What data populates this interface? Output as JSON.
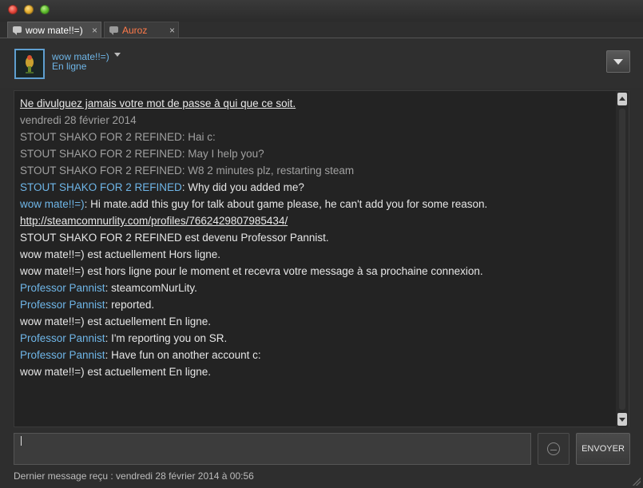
{
  "tabs": [
    {
      "label": "wow mate!!=)",
      "close": "×",
      "active": true
    },
    {
      "label": "Auroz",
      "close": "×",
      "active": false
    }
  ],
  "header": {
    "friend_name": "wow mate!!=)",
    "status": "En ligne"
  },
  "chat": {
    "notice": "Ne divulguez jamais votre mot de passe à qui que ce soit.",
    "date": "vendredi 28 février 2014",
    "old_messages": [
      {
        "sender": "STOUT SHAKO FOR 2 REFINED",
        "text": ": Hai c:"
      },
      {
        "sender": "STOUT SHAKO FOR 2 REFINED",
        "text": ": May I help you?"
      },
      {
        "sender": "STOUT SHAKO FOR 2 REFINED",
        "text": ": W8 2 minutes plz, restarting steam"
      }
    ],
    "msg_why": {
      "sender": "STOUT SHAKO FOR 2 REFINED",
      "text": ": Why did you added me?"
    },
    "msg_hi": {
      "sender": "wow mate!!=)",
      "text": ": Hi mate.add this guy for talk about game please, he can't add you for some reason."
    },
    "link": "http://steamcomnurlity.com/profiles/7662429807985434/",
    "sys_renamed": "STOUT SHAKO FOR 2 REFINED est devenu Professor Pannist.",
    "sys_offline": "wow mate!!=) est actuellement Hors ligne.",
    "sys_away": "wow mate!!=) est hors ligne pour le moment et recevra votre message à sa prochaine connexion.",
    "msg_p1": {
      "sender": "Professor Pannist",
      "text": ": steamcomNurLity."
    },
    "msg_p2": {
      "sender": "Professor Pannist",
      "text": ": reported."
    },
    "sys_online1": "wow mate!!=) est actuellement En ligne.",
    "msg_p3": {
      "sender": "Professor Pannist",
      "text": ": I'm reporting you on SR."
    },
    "msg_p4": {
      "sender": "Professor Pannist",
      "text": ": Have fun on another account c:"
    },
    "sys_online2": "wow mate!!=) est actuellement En ligne."
  },
  "compose": {
    "send_label": "ENVOYER",
    "value": ""
  },
  "footer": {
    "last_message": "Dernier message reçu : vendredi 28 février 2014 à 00:56"
  },
  "icons": {
    "tab": "chat-bubble-icon",
    "emoji": "emoticon-icon",
    "menu": "dropdown-arrow-icon"
  },
  "colors": {
    "name_blue": "#6fb6e8",
    "inactive_tab": "#ff7a4a",
    "background": "#2e2e2e"
  }
}
